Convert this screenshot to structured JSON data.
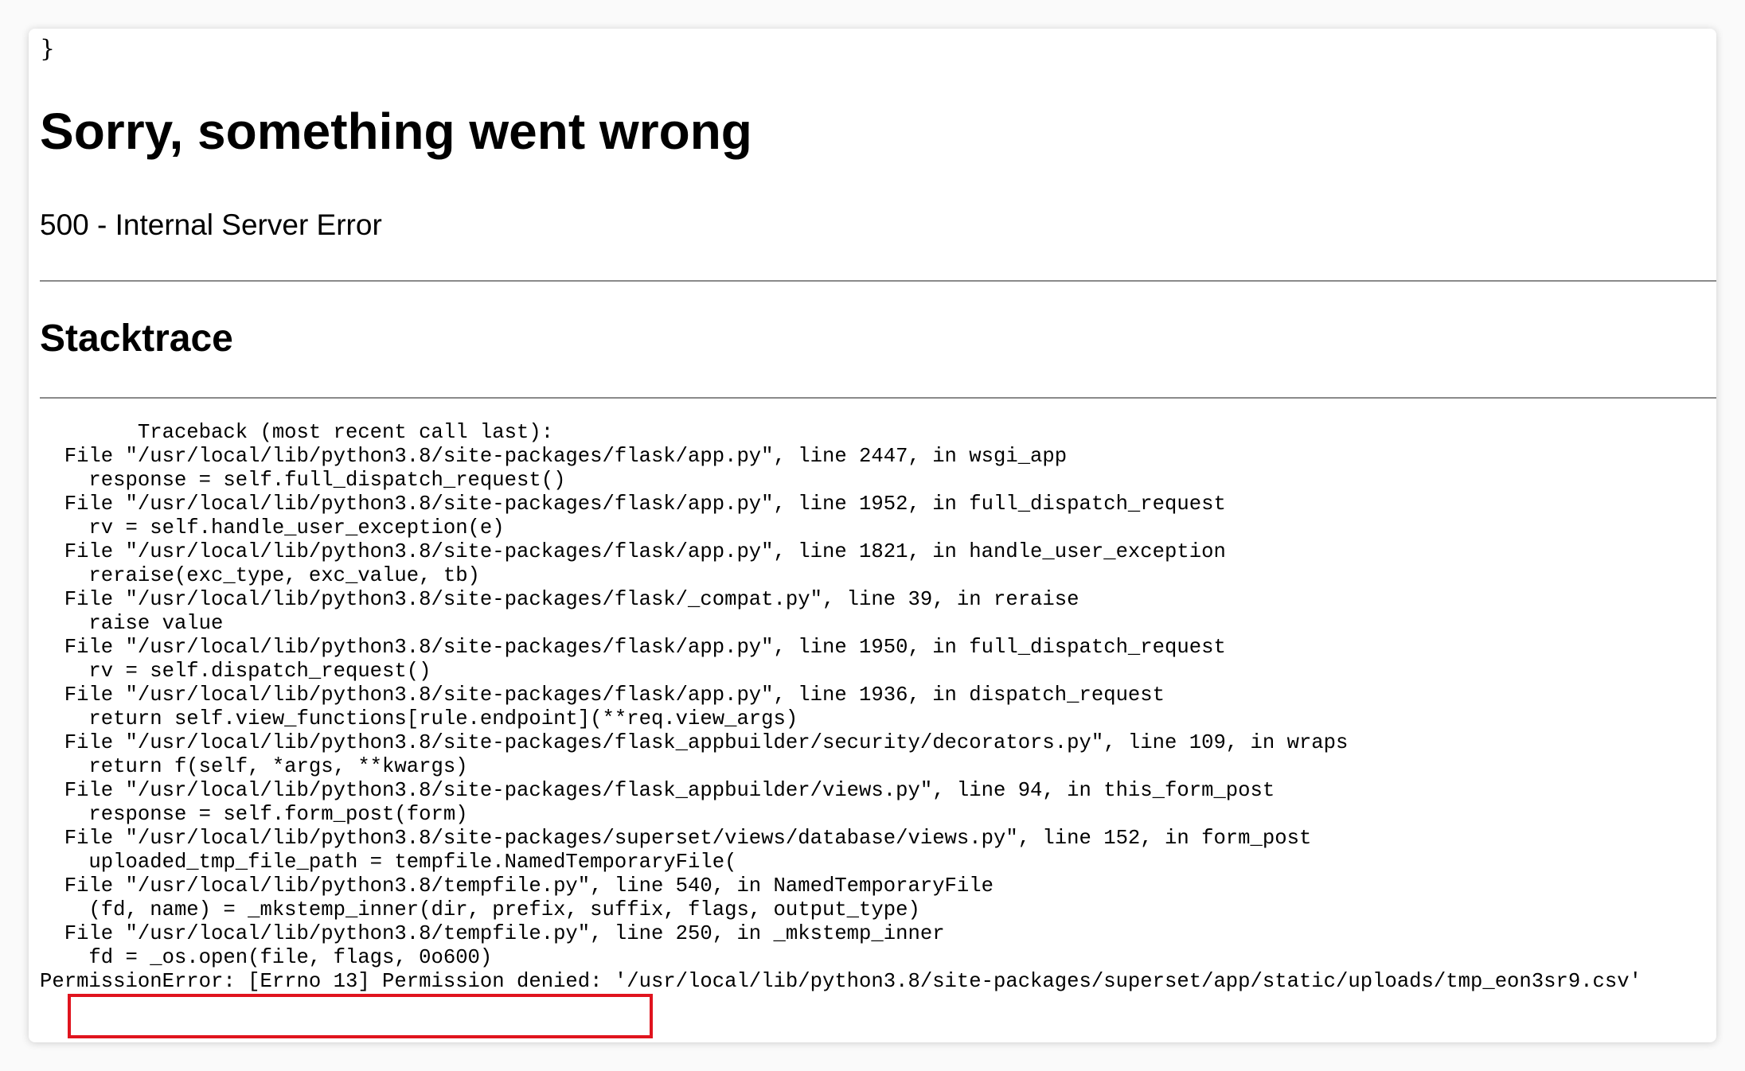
{
  "closing_brace": "}",
  "title": "Sorry, something went wrong",
  "subtitle": "500 - Internal Server Error",
  "stacktrace_heading": "Stacktrace",
  "traceback": [
    "        Traceback (most recent call last):",
    "  File \"/usr/local/lib/python3.8/site-packages/flask/app.py\", line 2447, in wsgi_app",
    "    response = self.full_dispatch_request()",
    "  File \"/usr/local/lib/python3.8/site-packages/flask/app.py\", line 1952, in full_dispatch_request",
    "    rv = self.handle_user_exception(e)",
    "  File \"/usr/local/lib/python3.8/site-packages/flask/app.py\", line 1821, in handle_user_exception",
    "    reraise(exc_type, exc_value, tb)",
    "  File \"/usr/local/lib/python3.8/site-packages/flask/_compat.py\", line 39, in reraise",
    "    raise value",
    "  File \"/usr/local/lib/python3.8/site-packages/flask/app.py\", line 1950, in full_dispatch_request",
    "    rv = self.dispatch_request()",
    "  File \"/usr/local/lib/python3.8/site-packages/flask/app.py\", line 1936, in dispatch_request",
    "    return self.view_functions[rule.endpoint](**req.view_args)",
    "  File \"/usr/local/lib/python3.8/site-packages/flask_appbuilder/security/decorators.py\", line 109, in wraps",
    "    return f(self, *args, **kwargs)",
    "  File \"/usr/local/lib/python3.8/site-packages/flask_appbuilder/views.py\", line 94, in this_form_post",
    "    response = self.form_post(form)",
    "  File \"/usr/local/lib/python3.8/site-packages/superset/views/database/views.py\", line 152, in form_post",
    "    uploaded_tmp_file_path = tempfile.NamedTemporaryFile(",
    "  File \"/usr/local/lib/python3.8/tempfile.py\", line 540, in NamedTemporaryFile",
    "    (fd, name) = _mkstemp_inner(dir, prefix, suffix, flags, output_type)",
    "  File \"/usr/local/lib/python3.8/tempfile.py\", line 250, in _mkstemp_inner",
    "    fd = _os.open(file, flags, 0o600)",
    "PermissionError: [Errno 13] Permission denied: '/usr/local/lib/python3.8/site-packages/superset/app/static/uploads/tmp_eon3sr9.csv'"
  ],
  "colors": {
    "highlight_border": "#e0141e",
    "rule": "#8a8a8a",
    "background": "#ffffff"
  }
}
